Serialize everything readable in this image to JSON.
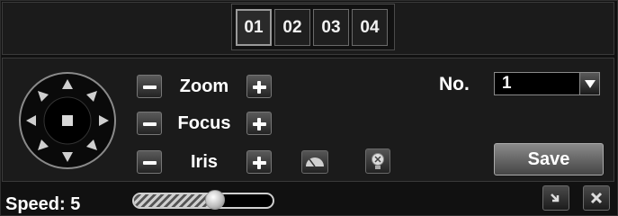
{
  "channels": {
    "tabs": [
      "01",
      "02",
      "03",
      "04"
    ],
    "active_index": 0
  },
  "ptz": {
    "directions": [
      "up",
      "up-right",
      "right",
      "down-right",
      "down",
      "down-left",
      "left",
      "up-left"
    ],
    "center_icon": "stop-square-icon"
  },
  "controls": [
    {
      "label": "Zoom"
    },
    {
      "label": "Focus"
    },
    {
      "label": "Iris"
    }
  ],
  "extra_icons": [
    "wiper-icon",
    "light-bulb-icon"
  ],
  "preset": {
    "label": "No.",
    "value": "1"
  },
  "save_label": "Save",
  "speed": {
    "label": "Speed: 5",
    "level_fraction": 0.58
  },
  "corner_icons": [
    "minimize-icon",
    "close-icon"
  ]
}
